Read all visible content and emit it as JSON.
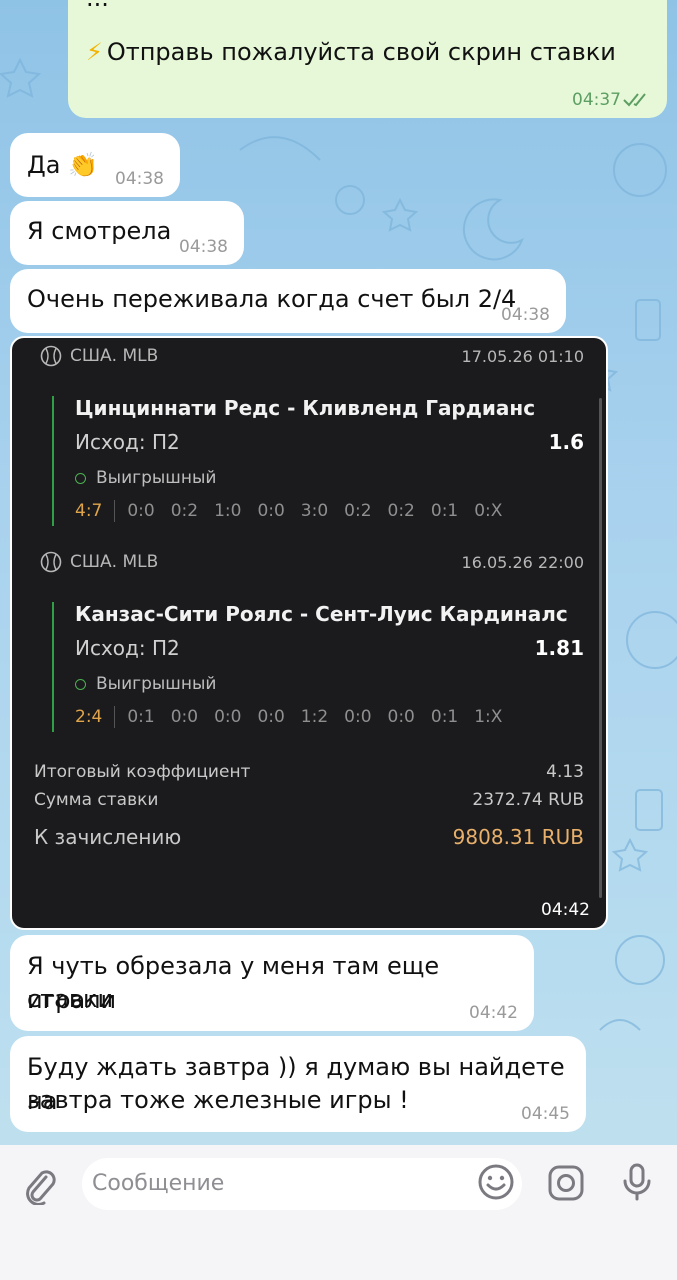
{
  "messages": {
    "out1": {
      "preview": "...",
      "icon": "lightning-emoji",
      "text": "Отправь пожалуйста свой скрин ставки",
      "time": "04:37"
    },
    "in1": {
      "text": "Да",
      "emoji": "👏",
      "time": "04:38"
    },
    "in2": {
      "text": "Я смотрела",
      "time": "04:38"
    },
    "in3": {
      "text": "Очень переживала когда счет был 2/4",
      "time": "04:38"
    },
    "in4": {
      "line1": "Я чуть обрезала у меня там еще играли",
      "line2": "ставки",
      "time": "04:42"
    },
    "in5": {
      "line1": "Буду ждать завтра )) я думаю вы найдете на",
      "line2": "завтра тоже железные игры !",
      "time": "04:45"
    }
  },
  "bet_card": {
    "events": [
      {
        "league": "США. MLB",
        "datetime": "17.05.26 01:10",
        "teams": "Цинциннати Редс - Кливленд Гардианс",
        "outcome": "Исход: П2",
        "odds": "1.6",
        "status": "Выигрышный",
        "final_score": "4:7",
        "periods": [
          "0:0",
          "0:2",
          "1:0",
          "0:0",
          "3:0",
          "0:2",
          "0:2",
          "0:1",
          "0:X"
        ]
      },
      {
        "league": "США. MLB",
        "datetime": "16.05.26 22:00",
        "teams": "Канзас-Сити Роялс - Сент-Луис Кардиналс",
        "outcome": "Исход: П2",
        "odds": "1.81",
        "status": "Выигрышный",
        "final_score": "2:4",
        "periods": [
          "0:1",
          "0:0",
          "0:0",
          "0:0",
          "1:2",
          "0:0",
          "0:0",
          "0:1",
          "1:X"
        ]
      }
    ],
    "total_odds_label": "Итоговый коэффициент",
    "total_odds": "4.13",
    "stake_label": "Сумма ставки",
    "stake": "2372.74 RUB",
    "payout_label": "К зачислению",
    "payout": "9808.31 RUB",
    "time": "04:42"
  },
  "composer": {
    "placeholder": "Сообщение",
    "icons": [
      "paperclip-icon",
      "emoji-icon",
      "camera-icon",
      "microphone-icon"
    ]
  },
  "colors": {
    "outgoing_bubble": "#e6f8d8",
    "win_green": "#4caf50",
    "payout_orange": "#e8b06a"
  }
}
